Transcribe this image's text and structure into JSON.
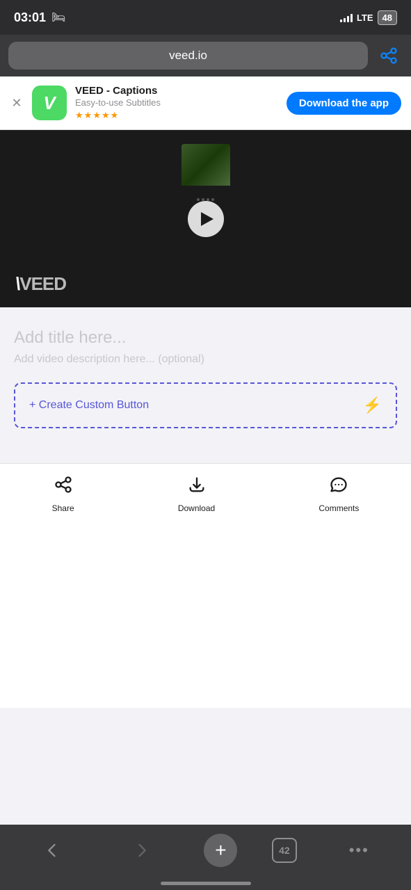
{
  "statusBar": {
    "time": "03:01",
    "lte": "LTE",
    "battery": "48"
  },
  "browser": {
    "url": "veed.io",
    "shareLabel": "share"
  },
  "appBanner": {
    "appName": "VEED - Captions",
    "appSubtitle": "Easy-to-use Subtitles",
    "stars": 5,
    "downloadLabel": "Download the app"
  },
  "video": {
    "veedLogo": "VEED"
  },
  "content": {
    "titlePlaceholder": "Add title here...",
    "descPlaceholder": "Add video description here... (optional)",
    "customButtonLabel": "+ Create Custom Button"
  },
  "actionBar": {
    "shareLabel": "Share",
    "downloadLabel": "Download",
    "commentsLabel": "Comments"
  },
  "bottomNav": {
    "tabCount": "42"
  }
}
